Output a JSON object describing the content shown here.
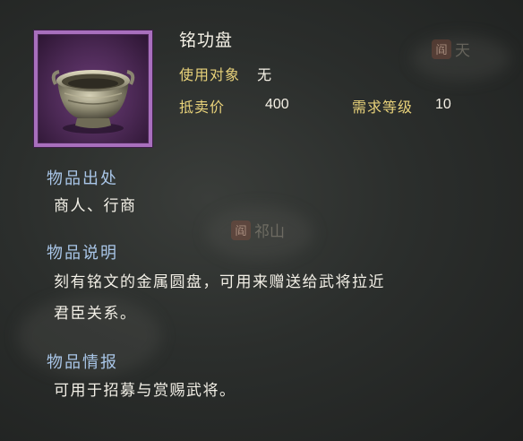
{
  "item": {
    "name": "铭功盘",
    "target_label": "使用对象",
    "target_value": "无",
    "price_label": "抵卖价",
    "price_value": "400",
    "level_label": "需求等级",
    "level_value": "10"
  },
  "sections": {
    "origin": {
      "heading": "物品出处",
      "text": "商人、行商"
    },
    "description": {
      "heading": "物品说明",
      "line1": "刻有铭文的金属圆盘，可用来赠送给武将拉近",
      "line2": "君臣关系。"
    },
    "info": {
      "heading": "物品情报",
      "text": "可用于招募与赏赐武将。"
    }
  },
  "background_map": {
    "place1": "祁山",
    "seal1": "阎",
    "place2": "天",
    "seal2": "阎"
  },
  "colors": {
    "frame": "#a86fbd",
    "label_gold": "#e8d27a",
    "heading_blue": "#a9c6e8"
  },
  "icons": {
    "item": "bronze-bowl-icon"
  }
}
